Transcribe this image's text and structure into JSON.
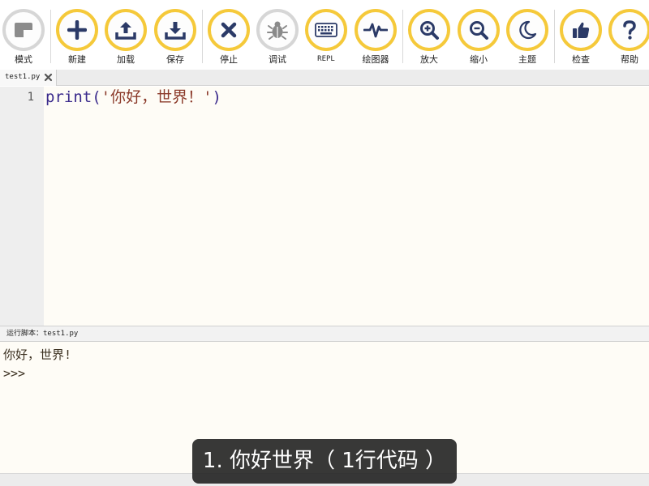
{
  "toolbar": {
    "accent_color": "#f5c93a",
    "buttons": [
      {
        "id": "mode",
        "label": "模式",
        "icon": "mode-icon"
      },
      {
        "id": "new",
        "label": "新建",
        "icon": "plus-icon"
      },
      {
        "id": "load",
        "label": "加载",
        "icon": "upload-icon"
      },
      {
        "id": "save",
        "label": "保存",
        "icon": "download-icon"
      },
      {
        "id": "stop",
        "label": "停止",
        "icon": "close-icon"
      },
      {
        "id": "debug",
        "label": "调试",
        "icon": "bug-icon"
      },
      {
        "id": "repl",
        "label": "REPL",
        "icon": "keyboard-icon"
      },
      {
        "id": "plotter",
        "label": "绘图器",
        "icon": "pulse-icon"
      },
      {
        "id": "zoom_in",
        "label": "放大",
        "icon": "zoom-in-icon"
      },
      {
        "id": "zoom_out",
        "label": "缩小",
        "icon": "zoom-out-icon"
      },
      {
        "id": "theme",
        "label": "主题",
        "icon": "moon-icon"
      },
      {
        "id": "check",
        "label": "检查",
        "icon": "thumbs-up-icon"
      },
      {
        "id": "help",
        "label": "帮助",
        "icon": "question-icon"
      }
    ]
  },
  "tabs": [
    {
      "label": "test1.py",
      "close_icon": "close-tab-icon"
    }
  ],
  "editor": {
    "lines": [
      {
        "number": "1",
        "func": "print",
        "open": "(",
        "string": "'你好，世界！'",
        "close": ")"
      }
    ]
  },
  "repl": {
    "header": "运行脚本：test1.py",
    "output": [
      "你好，世界!",
      ">>>"
    ]
  },
  "caption": {
    "text": "1. 你好世界（ 1行代码 ）"
  }
}
